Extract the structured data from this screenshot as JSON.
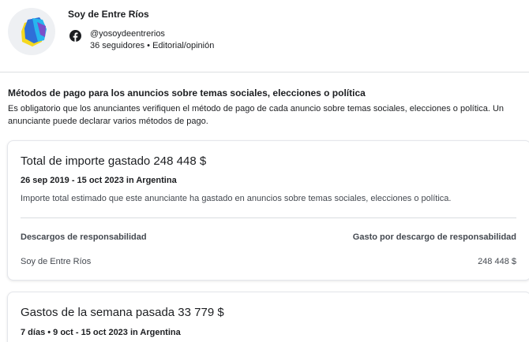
{
  "page": {
    "name": "Soy de Entre Ríos",
    "handle": "@yosoydeentrerios",
    "meta": "36 seguidores • Editorial/opinión",
    "social_icon": "facebook-icon",
    "brand_color": "#3b5998"
  },
  "payment_section": {
    "title": "Métodos de pago para los anuncios sobre temas sociales, elecciones o política",
    "description": "Es obligatorio que los anunciantes verifiquen el método de pago de cada anuncio sobre temas sociales, elecciones o política. Un anunciante puede declarar varios métodos de pago."
  },
  "total_card": {
    "title": "Total de importe gastado 248 448 $",
    "subtitle": "26 sep 2019 - 15 oct 2023 in Argentina",
    "description": "Importe total estimado que este anunciante ha gastado en anuncios sobre temas sociales, elecciones o política.",
    "columns": [
      "Descargos de responsabilidad",
      "Gasto por descargo de responsabilidad"
    ],
    "rows": [
      {
        "disclaimer": "Soy de Entre Ríos",
        "amount": "248 448 $"
      }
    ]
  },
  "weekly_card": {
    "title": "Gastos de la semana pasada 33 779 $",
    "subtitle": "7 días • 9 oct - 15 oct 2023 in Argentina"
  }
}
